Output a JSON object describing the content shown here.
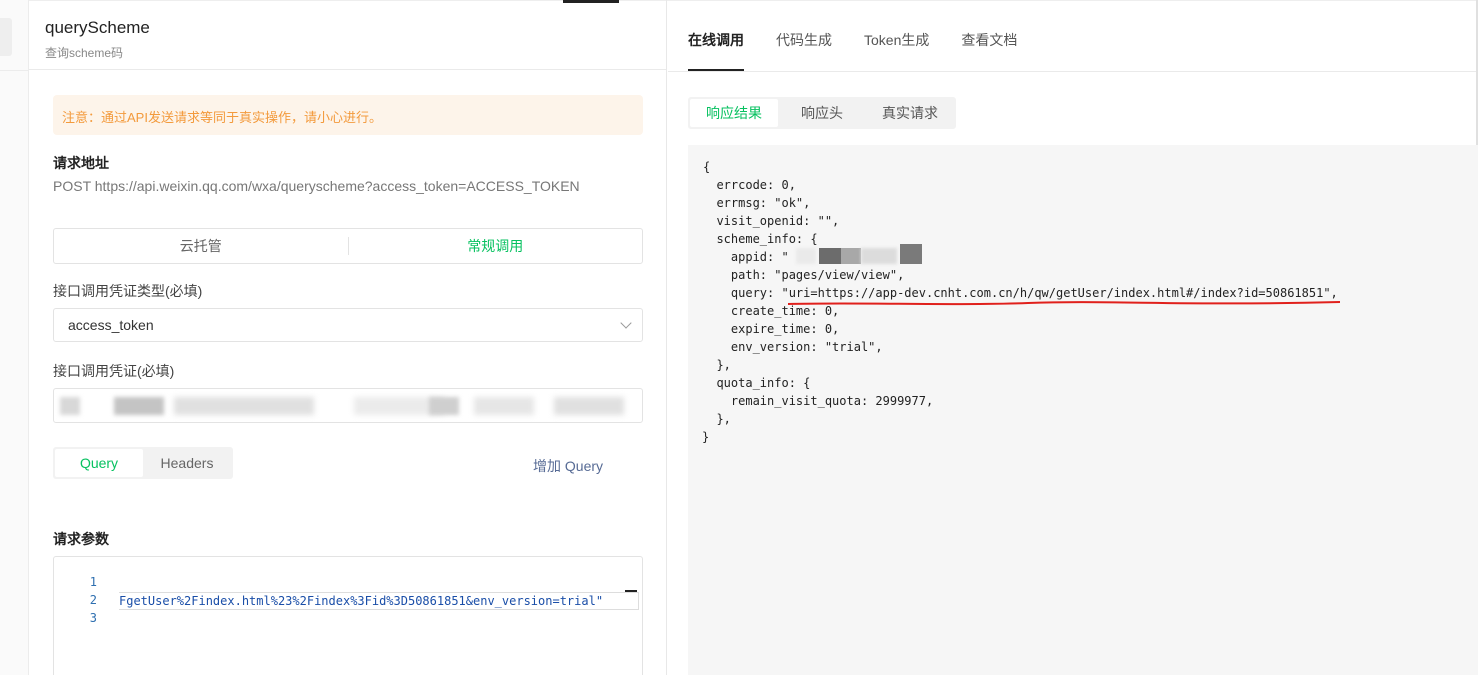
{
  "left_panel": {
    "title": "queryScheme",
    "subtitle": "查询scheme码",
    "warning": "注意：通过API发送请求等同于真实操作，请小心进行。",
    "request_url_label": "请求地址",
    "request_url": "POST https://api.weixin.qq.com/wxa/queryscheme?access_token=ACCESS_TOKEN",
    "mode_options": [
      "云托管",
      "常规调用"
    ],
    "mode_selected": "常规调用",
    "credential_type_label": "接口调用凭证类型(必填)",
    "credential_type_value": "access_token",
    "credential_label": "接口调用凭证(必填)",
    "param_tabs": [
      "Query",
      "Headers"
    ],
    "param_tab_selected": "Query",
    "add_query_label": "增加 Query",
    "request_params_label": "请求参数",
    "editor_line_numbers": [
      "1",
      "2",
      "3"
    ],
    "editor_line2": "FgetUser%2Findex.html%23%2Findex%3Fid%3D50861851&env_version=trial\""
  },
  "right_panel": {
    "tabs": [
      "在线调用",
      "代码生成",
      "Token生成",
      "查看文档"
    ],
    "tab_selected": "在线调用",
    "result_tabs": [
      "响应结果",
      "响应头",
      "真实请求"
    ],
    "result_tab_selected": "响应结果",
    "response_lines": [
      "{",
      "  errcode: 0,",
      "  errmsg: \"ok\",",
      "  visit_openid: \"\",",
      "  scheme_info: {",
      "    appid: \"",
      "    path: \"pages/view/view\",",
      "    query: \"uri=https://app-dev.cnht.com.cn/h/qw/getUser/index.html#/index?id=50861851\",",
      "    create_time: 0,",
      "    expire_time: 0,",
      "    env_version: \"trial\",",
      "  },",
      "  quota_info: {",
      "    remain_visit_quota: 2999977,",
      "  },",
      "}"
    ]
  },
  "colors": {
    "accent_green": "#07c160",
    "warning_text": "#f39a3c",
    "warning_bg": "#fdf4ea",
    "link_blue": "#576b95",
    "annotation_red": "#e0201c"
  }
}
